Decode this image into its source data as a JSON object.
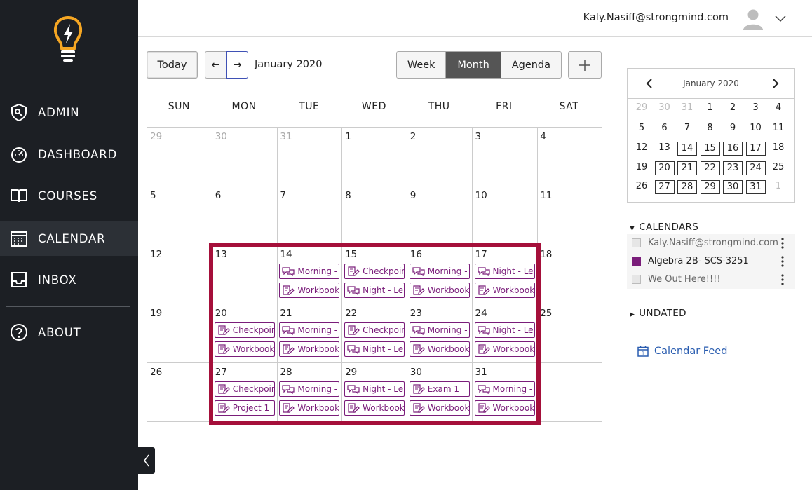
{
  "nav": {
    "items": [
      {
        "label": "ADMIN",
        "icon": "admin-key-icon"
      },
      {
        "label": "DASHBOARD",
        "icon": "dashboard-gauge-icon"
      },
      {
        "label": "COURSES",
        "icon": "book-icon"
      },
      {
        "label": "CALENDAR",
        "icon": "calendar-icon"
      },
      {
        "label": "INBOX",
        "icon": "inbox-icon"
      },
      {
        "label": "ABOUT",
        "icon": "question-icon"
      }
    ],
    "active": "CALENDAR"
  },
  "header": {
    "user_email": "Kaly.Nasiff@strongmind.com"
  },
  "toolbar": {
    "today_label": "Today",
    "prev_label": "←",
    "next_label": "→",
    "month_title": "January 2020",
    "views": [
      "Week",
      "Month",
      "Agenda"
    ],
    "active_view": "Month",
    "add_label": "+"
  },
  "weekdays": [
    "SUN",
    "MON",
    "TUE",
    "WED",
    "THU",
    "FRI",
    "SAT"
  ],
  "weeks": [
    [
      {
        "n": "29",
        "other": true
      },
      {
        "n": "30",
        "other": true
      },
      {
        "n": "31",
        "other": true
      },
      {
        "n": "1"
      },
      {
        "n": "2"
      },
      {
        "n": "3"
      },
      {
        "n": "4"
      }
    ],
    [
      {
        "n": "5"
      },
      {
        "n": "6"
      },
      {
        "n": "7"
      },
      {
        "n": "8"
      },
      {
        "n": "9"
      },
      {
        "n": "10"
      },
      {
        "n": "11"
      }
    ],
    [
      {
        "n": "12"
      },
      {
        "n": "13",
        "events": []
      },
      {
        "n": "14",
        "events": [
          {
            "t": "Morning -",
            "k": "chat"
          },
          {
            "t": "Workbook",
            "k": "edit"
          }
        ]
      },
      {
        "n": "15",
        "events": [
          {
            "t": "Checkpoin",
            "k": "edit"
          },
          {
            "t": "Night - Le",
            "k": "chat"
          }
        ]
      },
      {
        "n": "16",
        "events": [
          {
            "t": "Morning -",
            "k": "chat"
          },
          {
            "t": "Workbook",
            "k": "edit"
          }
        ]
      },
      {
        "n": "17",
        "events": [
          {
            "t": "Night - Le",
            "k": "chat"
          },
          {
            "t": "Workbook",
            "k": "edit"
          }
        ]
      },
      {
        "n": "18"
      }
    ],
    [
      {
        "n": "19"
      },
      {
        "n": "20",
        "events": [
          {
            "t": "Checkpoin",
            "k": "edit"
          },
          {
            "t": "Workbook",
            "k": "edit"
          }
        ]
      },
      {
        "n": "21",
        "events": [
          {
            "t": "Morning -",
            "k": "chat"
          },
          {
            "t": "Workbook",
            "k": "edit"
          }
        ]
      },
      {
        "n": "22",
        "events": [
          {
            "t": "Checkpoin",
            "k": "edit"
          },
          {
            "t": "Night - Le",
            "k": "chat"
          }
        ]
      },
      {
        "n": "23",
        "events": [
          {
            "t": "Morning -",
            "k": "chat"
          },
          {
            "t": "Workbook",
            "k": "edit"
          }
        ]
      },
      {
        "n": "24",
        "events": [
          {
            "t": "Night - Le",
            "k": "chat"
          },
          {
            "t": "Workbook",
            "k": "edit"
          }
        ]
      },
      {
        "n": "25"
      }
    ],
    [
      {
        "n": "26"
      },
      {
        "n": "27",
        "events": [
          {
            "t": "Checkpoin",
            "k": "edit"
          },
          {
            "t": "Project 1",
            "k": "edit"
          }
        ]
      },
      {
        "n": "28",
        "events": [
          {
            "t": "Morning -",
            "k": "chat"
          },
          {
            "t": "Workbook",
            "k": "edit"
          }
        ]
      },
      {
        "n": "29",
        "events": [
          {
            "t": "Night - Le",
            "k": "chat"
          },
          {
            "t": "Workbook",
            "k": "edit"
          }
        ]
      },
      {
        "n": "30",
        "events": [
          {
            "t": "Exam 1",
            "k": "edit"
          },
          {
            "t": "Workbook",
            "k": "edit"
          }
        ]
      },
      {
        "n": "31",
        "events": [
          {
            "t": "Morning -",
            "k": "chat"
          },
          {
            "t": "Workbook",
            "k": "edit"
          }
        ]
      },
      {
        "n": ""
      }
    ]
  ],
  "mini_calendar": {
    "title": "January 2020",
    "rows": [
      [
        {
          "n": "29",
          "other": true
        },
        {
          "n": "30",
          "other": true
        },
        {
          "n": "31",
          "other": true
        },
        {
          "n": "1"
        },
        {
          "n": "2"
        },
        {
          "n": "3"
        },
        {
          "n": "4"
        }
      ],
      [
        {
          "n": "5"
        },
        {
          "n": "6"
        },
        {
          "n": "7"
        },
        {
          "n": "8"
        },
        {
          "n": "9"
        },
        {
          "n": "10"
        },
        {
          "n": "11"
        }
      ],
      [
        {
          "n": "12"
        },
        {
          "n": "13"
        },
        {
          "n": "14",
          "boxed": true
        },
        {
          "n": "15",
          "boxed": true
        },
        {
          "n": "16",
          "boxed": true
        },
        {
          "n": "17",
          "boxed": true
        },
        {
          "n": "18"
        }
      ],
      [
        {
          "n": "19"
        },
        {
          "n": "20",
          "boxed": true
        },
        {
          "n": "21",
          "boxed": true
        },
        {
          "n": "22",
          "boxed": true
        },
        {
          "n": "23",
          "boxed": true
        },
        {
          "n": "24",
          "boxed": true
        },
        {
          "n": "25"
        }
      ],
      [
        {
          "n": "26"
        },
        {
          "n": "27",
          "boxed": true
        },
        {
          "n": "28",
          "boxed": true
        },
        {
          "n": "29",
          "boxed": true
        },
        {
          "n": "30",
          "boxed": true
        },
        {
          "n": "31",
          "boxed": true
        },
        {
          "n": "1",
          "other": true
        }
      ]
    ]
  },
  "calendars": {
    "header": "CALENDARS",
    "items": [
      {
        "name": "Kaly.Nasiff@strongmind.com",
        "color": "#e6e6e6",
        "checked": false
      },
      {
        "name": "Algebra 2B- SCS-3251",
        "color": "#7a1d7a",
        "checked": true
      },
      {
        "name": "We Out Here!!!!",
        "color": "#e6e6e6",
        "checked": false
      }
    ]
  },
  "undated": {
    "header": "UNDATED"
  },
  "feed": {
    "label": "Calendar Feed"
  },
  "colors": {
    "accent": "#7a1d7a",
    "highlight": "#a50f3a",
    "link": "#2a5db0",
    "sidebar": "#1c1f24"
  }
}
